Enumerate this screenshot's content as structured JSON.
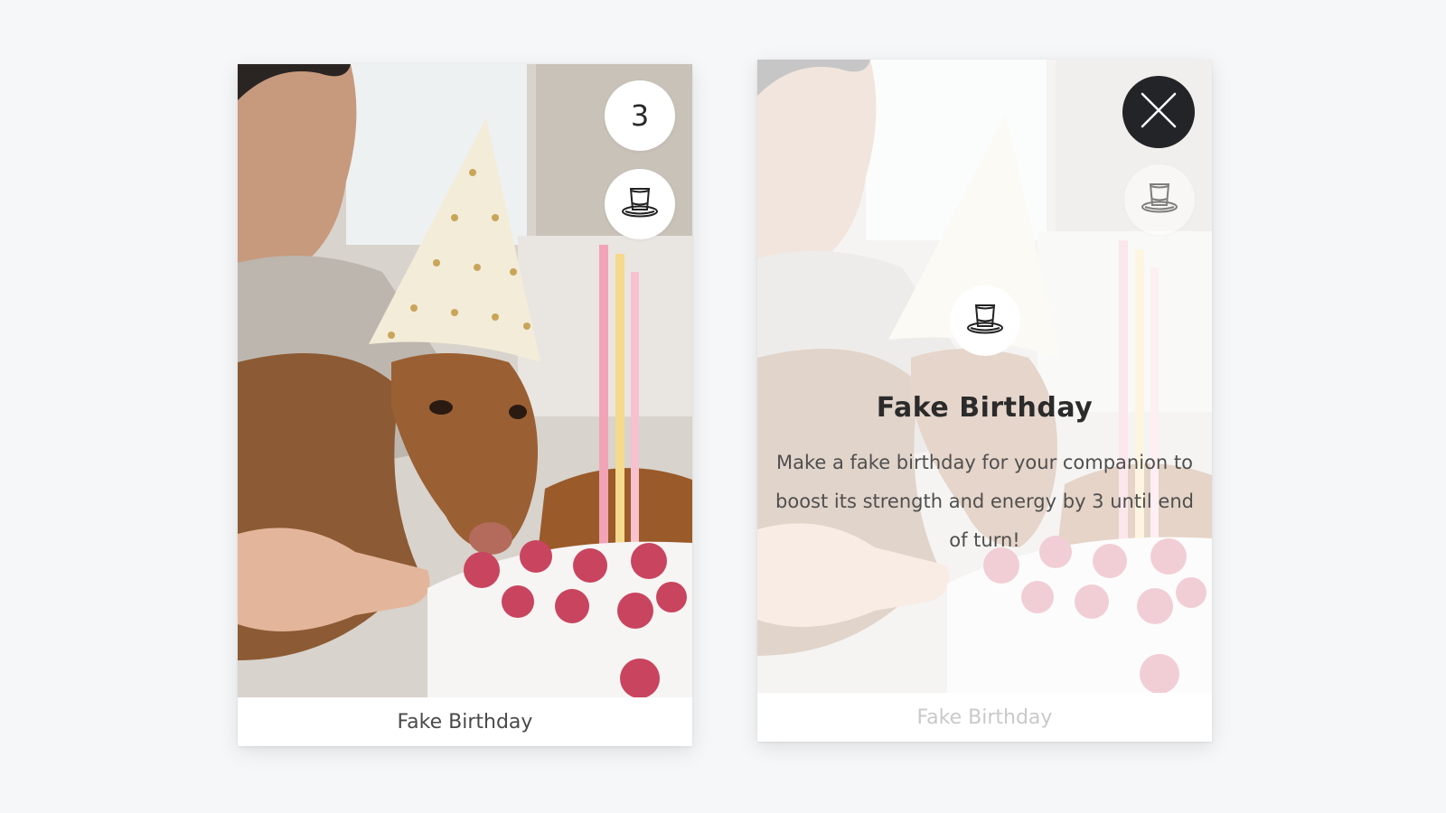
{
  "cards": [
    {
      "id": "card-a",
      "caption": "Fake Birthday",
      "cost": "3",
      "type_icon": "top-hat-icon",
      "image": "dog-in-party-hat-with-birthday-cake"
    },
    {
      "id": "card-b",
      "caption": "Fake Birthday",
      "close_icon": "close-icon",
      "type_icon": "top-hat-icon",
      "detail": {
        "title": "Fake Birthday",
        "description": "Make a fake birthday for your companion to boost its strength and energy by 3 until end of turn!"
      }
    }
  ],
  "colors": {
    "page_background": "#f6f7f9",
    "close_button": "#232427",
    "text_dark": "#2b2b2b"
  }
}
